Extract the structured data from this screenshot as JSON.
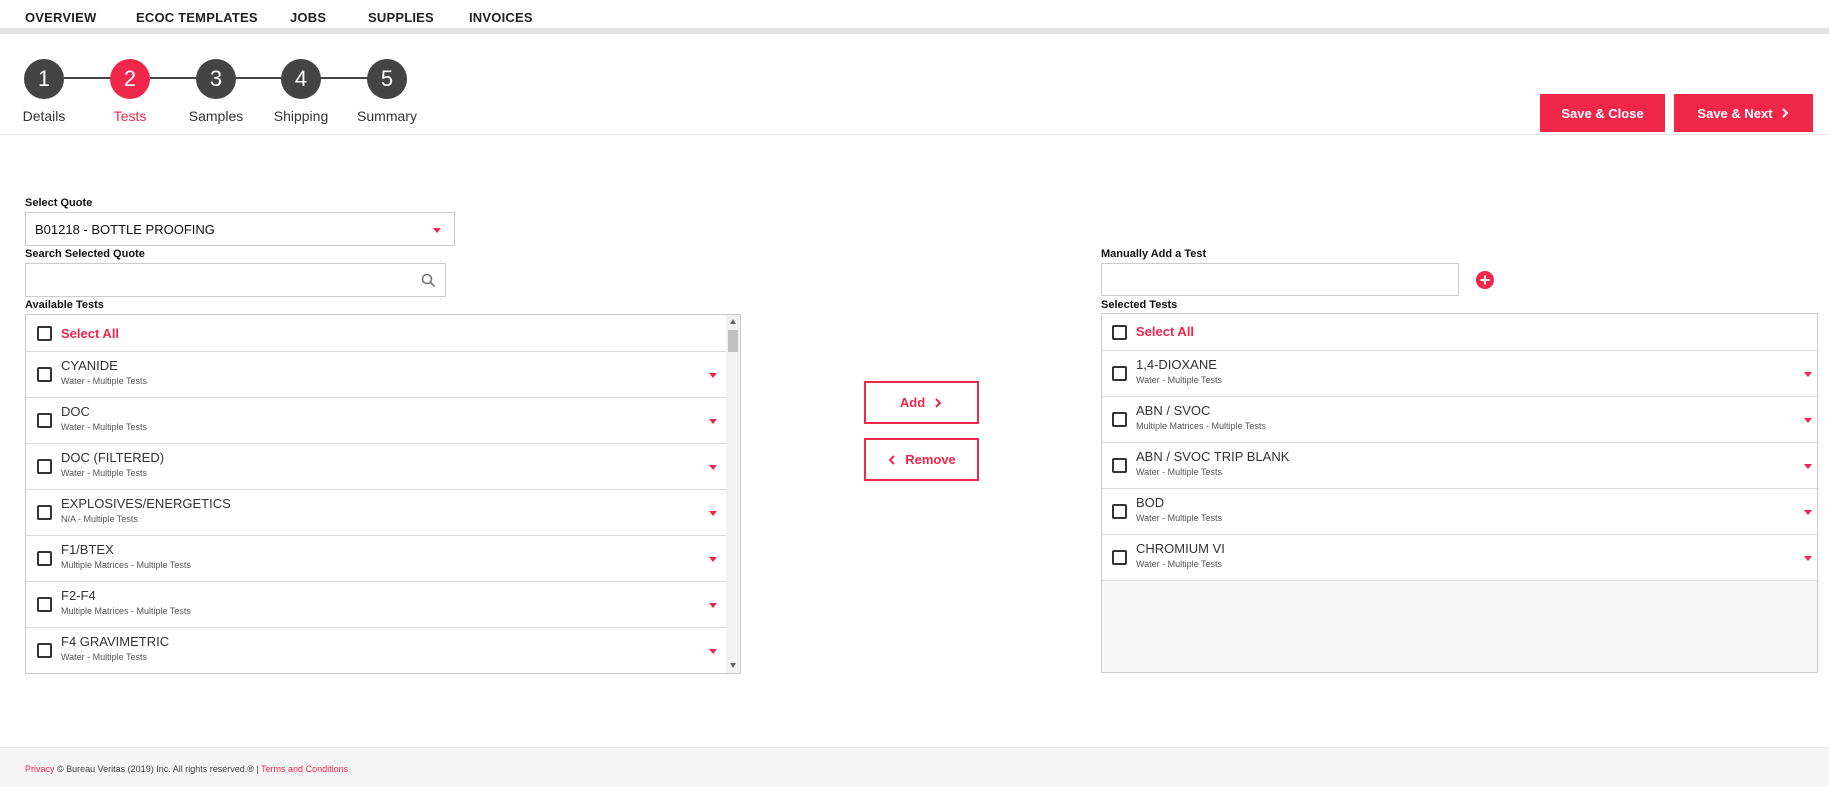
{
  "nav": {
    "items": [
      {
        "label": "OVERVIEW"
      },
      {
        "label": "ECOC TEMPLATES"
      },
      {
        "label": "JOBS"
      },
      {
        "label": "SUPPLIES"
      },
      {
        "label": "INVOICES"
      }
    ]
  },
  "stepper": {
    "active_step": 2,
    "steps": [
      {
        "number": "1",
        "label": "Details"
      },
      {
        "number": "2",
        "label": "Tests"
      },
      {
        "number": "3",
        "label": "Samples"
      },
      {
        "number": "4",
        "label": "Shipping"
      },
      {
        "number": "5",
        "label": "Summary"
      }
    ]
  },
  "actions": {
    "save_close_label": "Save & Close",
    "save_next_label": "Save & Next"
  },
  "quote": {
    "label": "Select Quote",
    "value": "B01218 - BOTTLE PROOFING",
    "search_label": "Search Selected Quote",
    "search_value": ""
  },
  "manual": {
    "label": "Manually Add a Test",
    "value": ""
  },
  "available": {
    "label": "Available Tests",
    "select_all_label": "Select All",
    "items": [
      {
        "name": "CYANIDE",
        "sub": "Water - Multiple Tests"
      },
      {
        "name": "DOC",
        "sub": "Water - Multiple Tests"
      },
      {
        "name": "DOC (FILTERED)",
        "sub": "Water - Multiple Tests"
      },
      {
        "name": "EXPLOSIVES/ENERGETICS",
        "sub": "N/A - Multiple Tests"
      },
      {
        "name": "F1/BTEX",
        "sub": "Multiple Matrices - Multiple Tests"
      },
      {
        "name": "F2-F4",
        "sub": "Multiple Matrices - Multiple Tests"
      },
      {
        "name": "F4 GRAVIMETRIC",
        "sub": "Water - Multiple Tests"
      }
    ]
  },
  "selected": {
    "label": "Selected Tests",
    "select_all_label": "Select All",
    "items": [
      {
        "name": "1,4-DIOXANE",
        "sub": "Water - Multiple Tests"
      },
      {
        "name": "ABN / SVOC",
        "sub": "Multiple Matrices - Multiple Tests"
      },
      {
        "name": "ABN / SVOC TRIP BLANK",
        "sub": "Water - Multiple Tests"
      },
      {
        "name": "BOD",
        "sub": "Water - Multiple Tests"
      },
      {
        "name": "CHROMIUM VI",
        "sub": "Water - Multiple Tests"
      }
    ]
  },
  "transfer": {
    "add_label": "Add",
    "remove_label": "Remove"
  },
  "footer": {
    "privacy": "Privacy",
    "copyright": " © Bureau Veritas (2019) Inc. All rights reserved.® | ",
    "terms": "Terms and Conditions"
  },
  "colors": {
    "accent": "#f0264a",
    "step_inactive": "#444444"
  },
  "icons": {
    "search": "search-icon",
    "add_circle": "plus-circle-icon",
    "chevron_right": "chevron-right-icon",
    "chevron_left": "chevron-left-icon",
    "dropdown": "caret-down-icon"
  }
}
